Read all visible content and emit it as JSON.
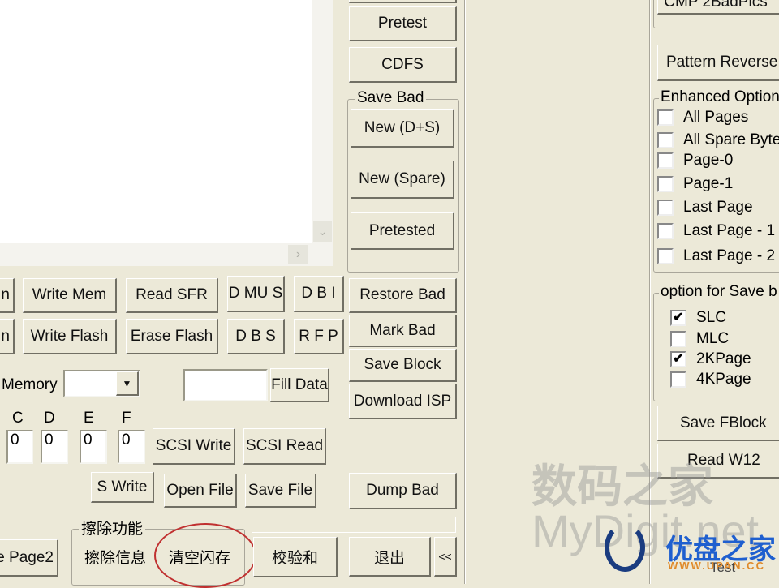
{
  "output_area": {
    "text": ""
  },
  "left": {
    "row1": [
      "n",
      "Write Mem",
      "Read SFR",
      "D MU S",
      "D B I"
    ],
    "row2": [
      "n",
      "Write Flash",
      "Erase Flash",
      "D B S",
      "R F P"
    ],
    "memory_label": "Memory",
    "memory_value": "",
    "fill_value": "",
    "fill_button": "Fill Data",
    "hex_labels": [
      "C",
      "D",
      "E",
      "F"
    ],
    "hex_values": [
      "0",
      "0",
      "0",
      "0"
    ],
    "scsi_write": "SCSI Write",
    "scsi_read": "SCSI Read",
    "s_write": "S Write",
    "open_file": "Open File",
    "save_file": "Save File",
    "page2": "e Page2",
    "erase_group": "擦除功能",
    "erase_info": "擦除信息",
    "clear_flash": "清空闪存",
    "checksum": "校验和"
  },
  "middle": {
    "pretest": "Pretest",
    "cdfs": "CDFS",
    "save_bad_group": "Save Bad",
    "new_ds": "New (D+S)",
    "new_spare": "New (Spare)",
    "pretested": "Pretested",
    "restore_bad": "Restore Bad",
    "mark_bad": "Mark Bad",
    "save_block": "Save Block",
    "download_isp": "Download ISP",
    "dump_bad": "Dump Bad",
    "exit": "退出",
    "collapse": "<<"
  },
  "right": {
    "cmp_button": "CMP 2BadPics",
    "pattern_reverse": "Pattern Reverse",
    "enhanced_group": "Enhanced Option",
    "enhanced": [
      {
        "label": "All Pages",
        "checked": false
      },
      {
        "label": "All Spare Byte",
        "checked": false
      },
      {
        "label": "Page-0",
        "checked": false
      },
      {
        "label": "Page-1",
        "checked": false
      },
      {
        "label": "Last Page",
        "checked": false
      },
      {
        "label": "Last Page - 1",
        "checked": false
      },
      {
        "label": "Last Page - 2",
        "checked": false
      }
    ],
    "save_group": "option for Save b",
    "save_options": [
      {
        "label": "SLC",
        "checked": true
      },
      {
        "label": "MLC",
        "checked": false
      },
      {
        "label": "2KPage",
        "checked": true
      },
      {
        "label": "4KPage",
        "checked": false
      }
    ],
    "save_fblock": "Save FBlock",
    "read_w12": "Read W12",
    "test": "Test"
  },
  "watermarks": {
    "cn": "数码之家",
    "en": "MyDigit.net",
    "logo": "优盘之家",
    "logo_url": "WWW.UPAN.CC"
  },
  "colors": {
    "background": "#ece9d8",
    "annotation": "#c03030"
  }
}
